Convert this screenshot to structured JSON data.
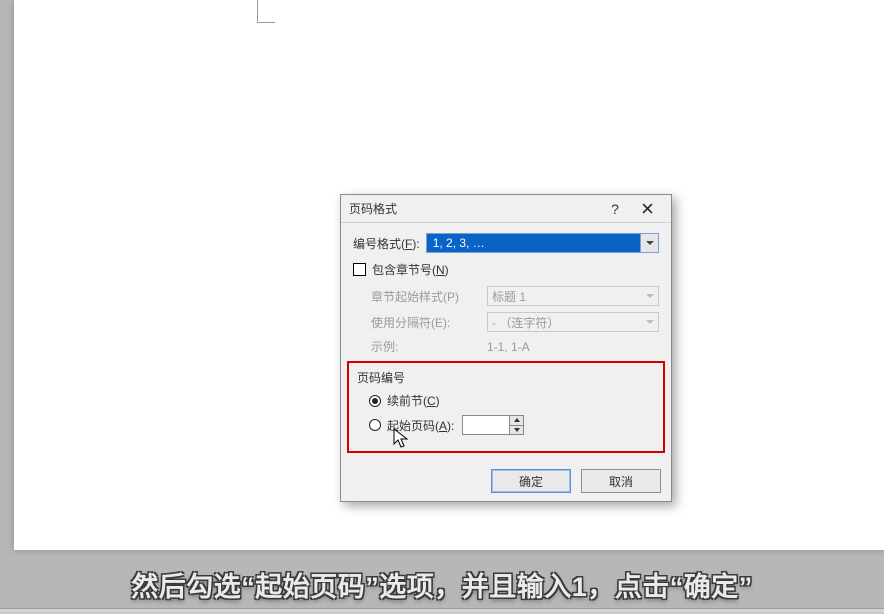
{
  "dialog": {
    "title": "页码格式",
    "help_symbol": "?",
    "format": {
      "label_pre": "编号格式(",
      "hotkey": "F",
      "label_post": "):",
      "value": "1, 2, 3, …"
    },
    "chapter": {
      "checkbox_pre": "包含章节号(",
      "checkbox_hotkey": "N",
      "checkbox_post": ")",
      "start_style_label": "章节起始样式(P)",
      "start_style_value": "标题 1",
      "separator_label": "使用分隔符(E):",
      "separator_value": "-  （连字符）",
      "example_label": "示例:",
      "example_value": "1-1, 1-A"
    },
    "numbering": {
      "group_title": "页码编号",
      "continue_pre": "续前节(",
      "continue_hotkey": "C",
      "continue_post": ")",
      "start_at_pre": "起始页码(",
      "start_at_hotkey": "A",
      "start_at_post": "):",
      "start_at_value": ""
    },
    "buttons": {
      "ok": "确定",
      "cancel": "取消"
    }
  },
  "subtitle": "然后勾选“起始页码”选项，并且输入1，点击“确定”",
  "colors": {
    "highlight_selection": "#0a64c8",
    "emphasis_border": "#d40000"
  }
}
